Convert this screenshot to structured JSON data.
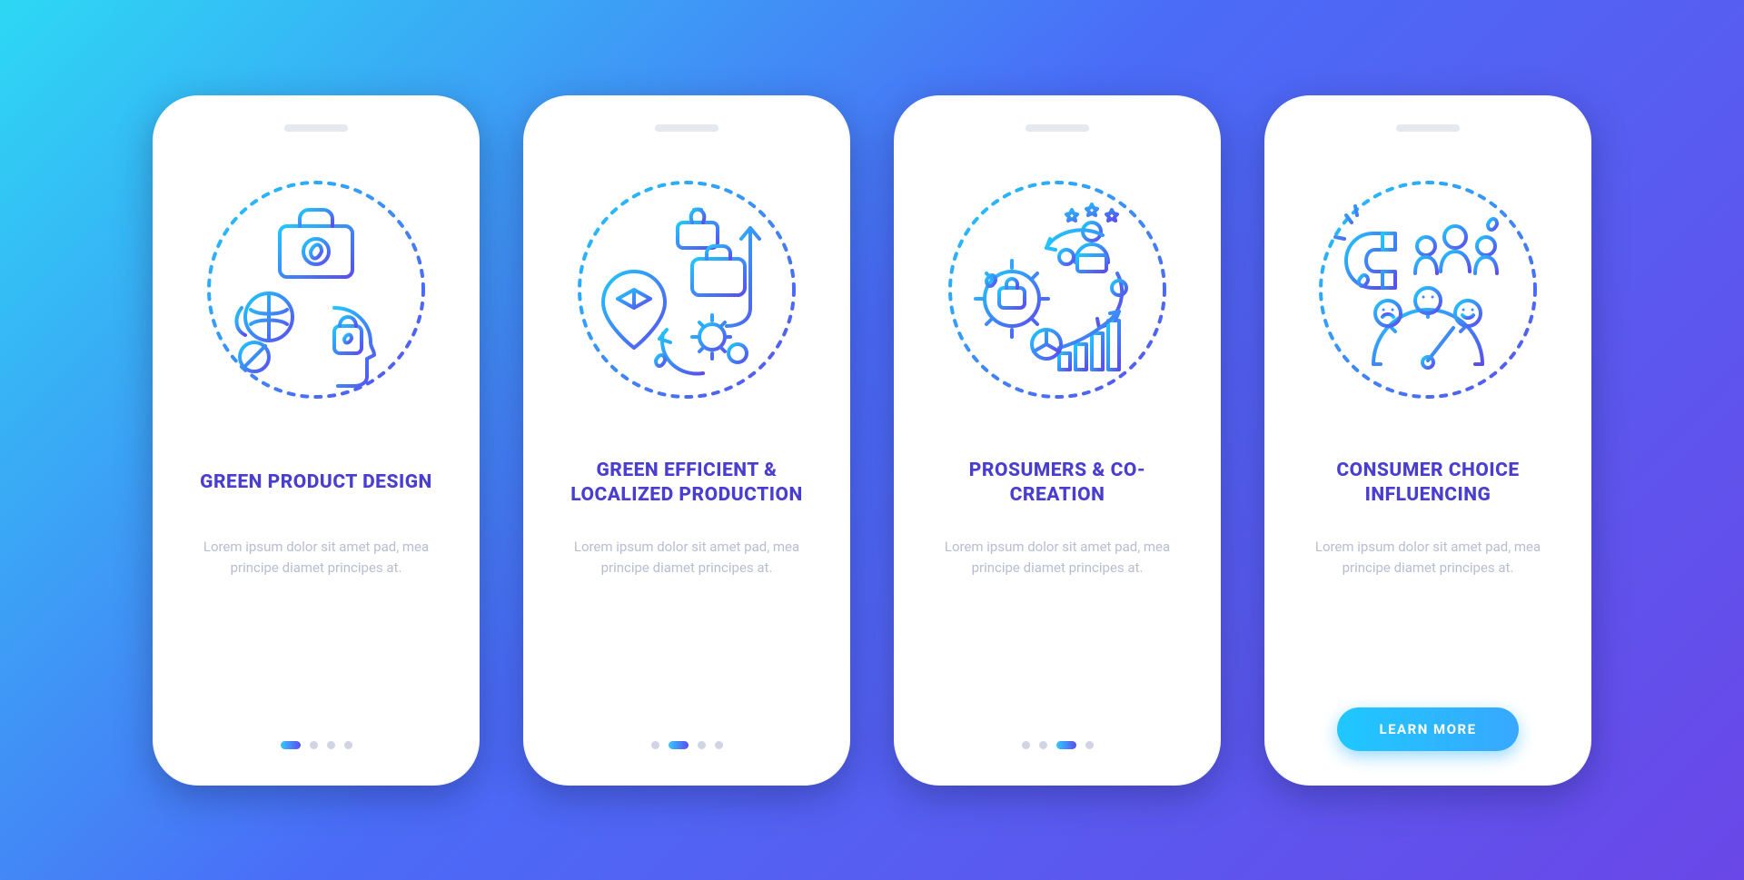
{
  "colors": {
    "accent_gradient_start": "#1fc8ff",
    "accent_gradient_end": "#5a4df0",
    "title": "#4a3ed0",
    "body": "#b8bdd1",
    "dot_inactive": "#d0d4e4"
  },
  "cta_label": "LEARN MORE",
  "body_text": "Lorem ipsum dolor sit amet pad, mea principe diamet principes at.",
  "screens": [
    {
      "title": "GREEN PRODUCT DESIGN",
      "icon": "green-product-design-icon",
      "active_dot": 0,
      "show_cta": false
    },
    {
      "title": "GREEN EFFICIENT & LOCALIZED PRODUCTION",
      "icon": "localized-production-icon",
      "active_dot": 1,
      "show_cta": false
    },
    {
      "title": "PROSUMERS & CO-CREATION",
      "icon": "prosumers-cocreation-icon",
      "active_dot": 2,
      "show_cta": false
    },
    {
      "title": "CONSUMER CHOICE INFLUENCING",
      "icon": "consumer-choice-icon",
      "active_dot": 3,
      "show_cta": true
    }
  ]
}
